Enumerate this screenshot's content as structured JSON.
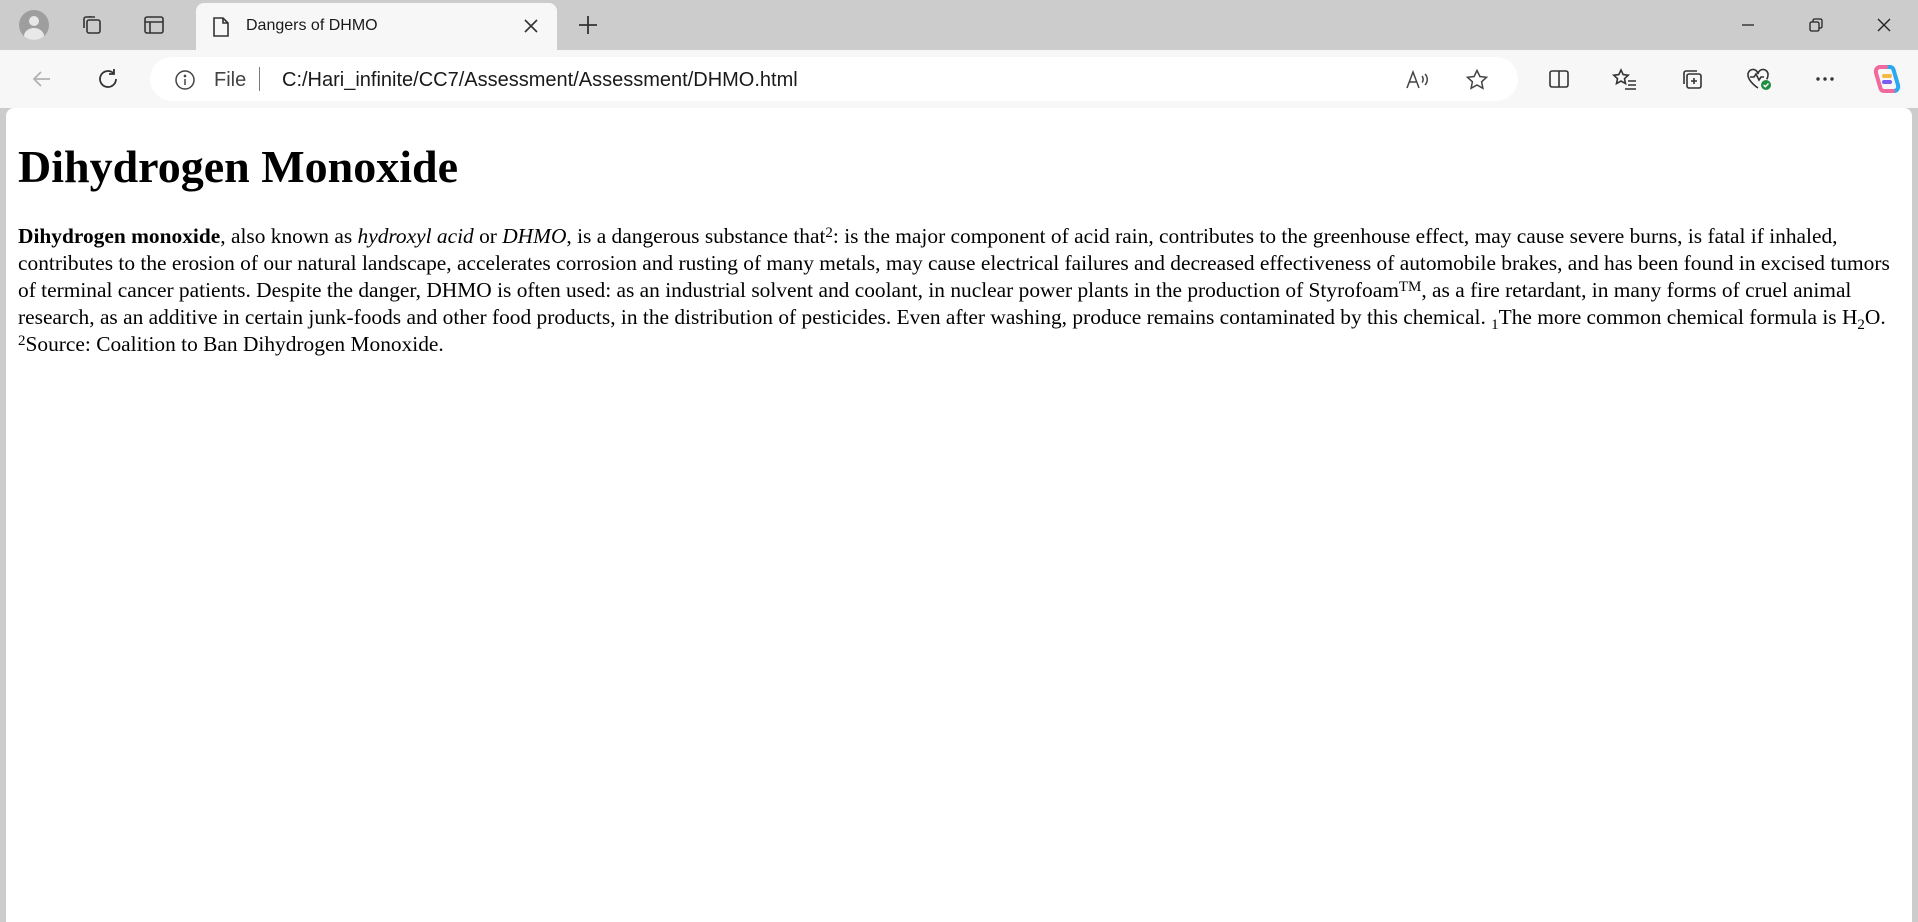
{
  "browser": {
    "tab_title": "Dangers of DHMO",
    "address": {
      "scheme_label": "File",
      "url": "C:/Hari_infinite/CC7/Assessment/Assessment/DHMO.html"
    }
  },
  "page": {
    "heading": "Dihydrogen Monoxide",
    "para": {
      "s1_bold": "Dihydrogen monoxide",
      "s2": ", also known as ",
      "s3_italic": "hydroxyl acid",
      "s4": " or ",
      "s5_italic": "DHMO",
      "s6": ", is a dangerous substance that",
      "sup_2a": "2",
      "s7": ": is the major component of acid rain, contributes to the greenhouse effect, may cause severe burns, is fatal if inhaled, contributes to the erosion of our natural landscape, accelerates corrosion and rusting of many metals, may cause electrical failures and decreased effectiveness of automobile brakes, and has been found in excised tumors of terminal cancer patients. Despite the danger, DHMO is often used: as an industrial solvent and coolant, in nuclear power plants in the production of Styrofoam",
      "sup_tm": "TM",
      "s8": ", as a fire retardant, in many forms of cruel animal research, as an additive in certain junk-foods and other food products, in the distribution of pesticides. Even after washing, produce remains contaminated by this chemical. ",
      "sub_1": "1",
      "s9": "The more common chemical formula is H",
      "sub_2": "2",
      "s10": "O. ",
      "sup_2b": "2",
      "s11": "Source: Coalition to Ban Dihydrogen Monoxide."
    }
  }
}
